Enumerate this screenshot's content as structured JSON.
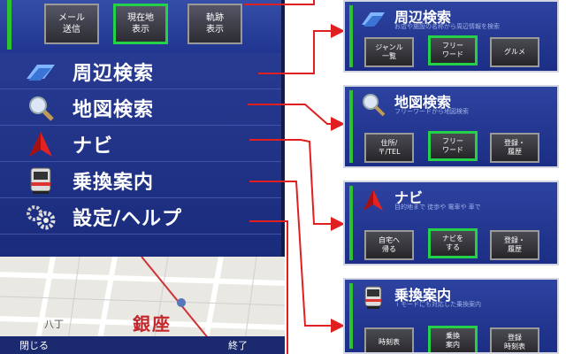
{
  "phone": {
    "top_buttons": [
      {
        "label": "メール\n送信"
      },
      {
        "label": "現在地\n表示"
      },
      {
        "label": "軌跡\n表示"
      }
    ],
    "menu": [
      {
        "label": "周辺検索",
        "icon": "building-icon"
      },
      {
        "label": "地図検索",
        "icon": "magnifier-icon"
      },
      {
        "label": "ナビ",
        "icon": "navi-arrow-icon"
      },
      {
        "label": "乗換案内",
        "icon": "train-icon"
      },
      {
        "label": "設定/ヘルプ",
        "icon": "gear-icon"
      }
    ],
    "map": {
      "city_label": "銀座",
      "district_label": "八丁"
    },
    "softkeys": {
      "left": "閉じる",
      "right": "終了"
    }
  },
  "panels": [
    {
      "title": "周辺検索",
      "subtitle": "お店や施設の名称から周辺情報を検索",
      "icon": "building-icon",
      "buttons": [
        {
          "label": "ジャンル\n一覧"
        },
        {
          "label": "フリー\nワード"
        },
        {
          "label": "グルメ"
        }
      ]
    },
    {
      "title": "地図検索",
      "subtitle": "フリーワードから地図検索",
      "icon": "magnifier-icon",
      "buttons": [
        {
          "label": "住所/\n〒/TEL"
        },
        {
          "label": "フリー\nワード"
        },
        {
          "label": "登録・\n履歴"
        }
      ]
    },
    {
      "title": "ナビ",
      "subtitle": "目的地まで 徒歩や 電車や 車で",
      "icon": "navi-arrow-icon",
      "buttons": [
        {
          "label": "自宅へ\n帰る"
        },
        {
          "label": "ナビを\nする"
        },
        {
          "label": "登録・\n履歴"
        }
      ]
    },
    {
      "title": "乗換案内",
      "subtitle": "ｉモードにも対応した乗換案内",
      "icon": "train-icon",
      "buttons": [
        {
          "label": "時刻表"
        },
        {
          "label": "乗換\n案内"
        },
        {
          "label": "登録\n時刻表"
        }
      ]
    }
  ],
  "colors": {
    "highlight": "#24d148",
    "arrow": "#e02020",
    "panel": "#2d43a0"
  }
}
